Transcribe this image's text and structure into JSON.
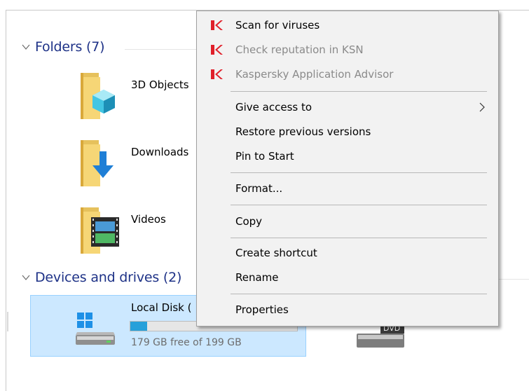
{
  "explorer": {
    "folders_header": "Folders (7)",
    "devices_header": "Devices and drives (2)",
    "folders": [
      {
        "label": "3D Objects",
        "icon": "3d-objects-folder-icon"
      },
      {
        "label": "Downloads",
        "icon": "downloads-folder-icon"
      },
      {
        "label": "Videos",
        "icon": "videos-folder-icon"
      }
    ],
    "drive": {
      "name": "Local Disk (",
      "free_text": "179 GB free of 199 GB",
      "used_fraction": 0.1,
      "icon": "windows-drive-icon"
    },
    "dvd_label": "DVD"
  },
  "context_menu": {
    "items": [
      {
        "label": "Scan for viruses",
        "icon": "kaspersky-icon",
        "disabled": false
      },
      {
        "label": "Check reputation in KSN",
        "icon": "kaspersky-icon",
        "disabled": true
      },
      {
        "label": "Kaspersky Application Advisor",
        "icon": "kaspersky-icon",
        "disabled": true
      },
      {
        "label": "Give access to",
        "submenu": true
      },
      {
        "label": "Restore previous versions"
      },
      {
        "label": "Pin to Start"
      },
      {
        "label": "Format..."
      },
      {
        "label": "Copy"
      },
      {
        "label": "Create shortcut"
      },
      {
        "label": "Rename"
      },
      {
        "label": "Properties"
      }
    ]
  },
  "colors": {
    "group_header": "#1e3287",
    "selection_bg": "#cce8ff",
    "progress": "#26a0da",
    "menu_bg": "#f2f2f2"
  }
}
